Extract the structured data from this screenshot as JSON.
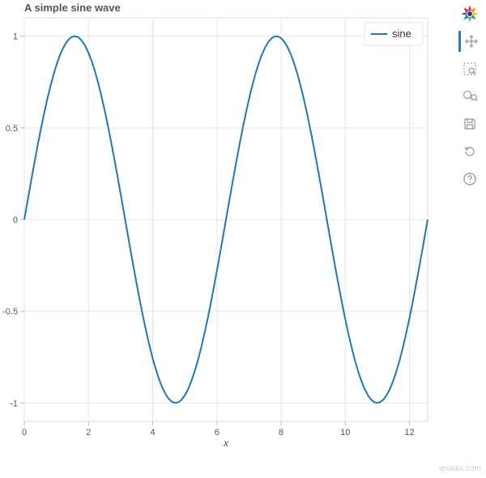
{
  "chart_data": {
    "type": "line",
    "title": "A simple sine wave",
    "xlabel": "x",
    "ylabel": "",
    "xlim": [
      0,
      12.566370614
    ],
    "ylim": [
      -1.1,
      1.1
    ],
    "x_ticks": [
      0,
      2,
      4,
      6,
      8,
      10,
      12
    ],
    "y_ticks": [
      -1,
      -0.5,
      0,
      0.5,
      1
    ],
    "grid": true,
    "legend_position": "top-right",
    "series": [
      {
        "name": "sine",
        "color": "#1f77b4",
        "x": [
          0,
          0.1,
          0.2,
          0.3,
          0.4,
          0.5,
          0.6,
          0.7,
          0.8,
          0.9,
          1.0,
          1.1,
          1.2,
          1.3,
          1.4,
          1.5,
          1.6,
          1.7,
          1.8,
          1.9,
          2.0,
          2.1,
          2.2,
          2.3,
          2.4,
          2.5,
          2.6,
          2.7,
          2.8,
          2.9,
          3.0,
          3.1,
          3.2,
          3.3,
          3.4,
          3.5,
          3.6,
          3.7,
          3.8,
          3.9,
          4.0,
          4.1,
          4.2,
          4.3,
          4.4,
          4.5,
          4.6,
          4.7,
          4.8,
          4.9,
          5.0,
          5.1,
          5.2,
          5.3,
          5.4,
          5.5,
          5.6,
          5.7,
          5.8,
          5.9,
          6.0,
          6.1,
          6.2,
          6.3,
          6.4,
          6.5,
          6.6,
          6.7,
          6.8,
          6.9,
          7.0,
          7.1,
          7.2,
          7.3,
          7.4,
          7.5,
          7.6,
          7.7,
          7.8,
          7.9,
          8.0,
          8.1,
          8.2,
          8.3,
          8.4,
          8.5,
          8.6,
          8.7,
          8.8,
          8.9,
          9.0,
          9.1,
          9.2,
          9.3,
          9.4,
          9.5,
          9.6,
          9.7,
          9.8,
          9.9,
          10.0,
          10.1,
          10.2,
          10.3,
          10.4,
          10.5,
          10.6,
          10.7,
          10.8,
          10.9,
          11.0,
          11.1,
          11.2,
          11.3,
          11.4,
          11.5,
          11.6,
          11.7,
          11.8,
          11.9,
          12.0,
          12.1,
          12.2,
          12.3,
          12.4,
          12.5,
          12.566370614
        ],
        "y": [
          0.0,
          0.0998,
          0.1987,
          0.2955,
          0.3894,
          0.4794,
          0.5646,
          0.6442,
          0.7174,
          0.7833,
          0.8415,
          0.8912,
          0.932,
          0.9636,
          0.9854,
          0.9975,
          0.9996,
          0.9917,
          0.9738,
          0.9463,
          0.9093,
          0.8632,
          0.8085,
          0.7457,
          0.6755,
          0.5985,
          0.5155,
          0.4274,
          0.335,
          0.2392,
          0.1411,
          0.0416,
          -0.0584,
          -0.1577,
          -0.2555,
          -0.3508,
          -0.4425,
          -0.5298,
          -0.6119,
          -0.6878,
          -0.7568,
          -0.8183,
          -0.8716,
          -0.9162,
          -0.9516,
          -0.9775,
          -0.9937,
          -0.9999,
          -0.9962,
          -0.9825,
          -0.9589,
          -0.9258,
          -0.8835,
          -0.8323,
          -0.7728,
          -0.7055,
          -0.6313,
          -0.5507,
          -0.4646,
          -0.3739,
          -0.2794,
          -0.1822,
          -0.0831,
          0.0168,
          0.1165,
          0.2151,
          0.3115,
          0.4048,
          0.4941,
          0.5784,
          0.657,
          0.729,
          0.7937,
          0.8504,
          0.8987,
          0.938,
          0.9679,
          0.9882,
          0.9985,
          0.9989,
          0.9894,
          0.9699,
          0.9407,
          0.9022,
          0.8546,
          0.7985,
          0.7344,
          0.663,
          0.5849,
          0.501,
          0.4121,
          0.3191,
          0.2229,
          0.1245,
          0.0248,
          -0.0752,
          -0.1743,
          -0.2718,
          -0.3665,
          -0.4575,
          -0.544,
          -0.6251,
          -0.6999,
          -0.7677,
          -0.8278,
          -0.8797,
          -0.9228,
          -0.9566,
          -0.9809,
          -0.9954,
          -0.9999,
          -0.9945,
          -0.9792,
          -0.954,
          -0.9193,
          -0.8755,
          -0.8228,
          -0.762,
          -0.6935,
          -0.6181,
          -0.5366,
          -0.4496,
          -0.3582,
          -0.2632,
          -0.1656,
          -0.0664,
          0.0
        ]
      }
    ]
  },
  "toolbar": {
    "items": [
      {
        "name": "bokeh-logo-icon",
        "interact": false
      },
      {
        "name": "pan-tool-icon",
        "interact": true,
        "active": true
      },
      {
        "name": "box-zoom-tool-icon",
        "interact": true
      },
      {
        "name": "wheel-zoom-tool-icon",
        "interact": true
      },
      {
        "name": "save-tool-icon",
        "interact": true
      },
      {
        "name": "reset-tool-icon",
        "interact": true
      },
      {
        "name": "help-tool-icon",
        "interact": true
      }
    ]
  },
  "watermark": "wsxdn.com"
}
